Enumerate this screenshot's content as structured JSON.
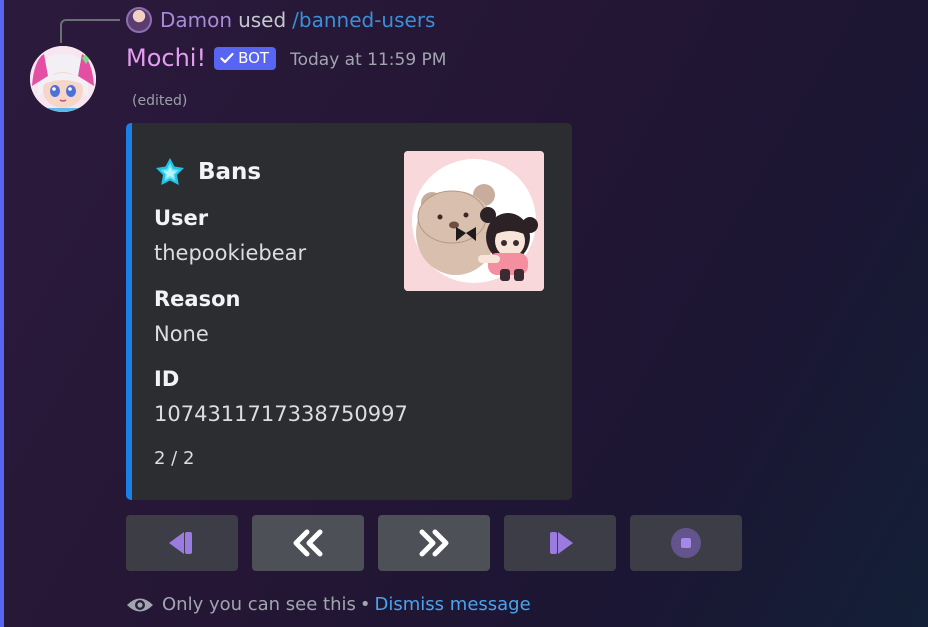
{
  "reply": {
    "username": "Damon",
    "used_text": "used",
    "command": "/banned-users"
  },
  "message": {
    "bot_name": "Mochi!",
    "bot_badge": "BOT",
    "timestamp": "Today at 11:59 PM",
    "edited_label": "(edited)"
  },
  "embed": {
    "title": "Bans",
    "accent_color": "#1a7fe6",
    "fields": [
      {
        "name": "User",
        "value": "thepookiebear"
      },
      {
        "name": "Reason",
        "value": "None"
      },
      {
        "name": "ID",
        "value": "1074311717338750997"
      }
    ],
    "footer": "2 / 2"
  },
  "buttons": [
    {
      "icon": "first-page-icon"
    },
    {
      "icon": "previous-page-icon"
    },
    {
      "icon": "next-page-icon"
    },
    {
      "icon": "last-page-icon"
    },
    {
      "icon": "stop-icon"
    }
  ],
  "ephemeral": {
    "notice": "Only you can see this",
    "separator": "•",
    "dismiss_label": "Dismiss message"
  },
  "colors": {
    "bot_name": "#e39cf0",
    "badge": "#5865f2",
    "link": "#4aa3f0",
    "button_icon_purple": "#a784f0"
  }
}
